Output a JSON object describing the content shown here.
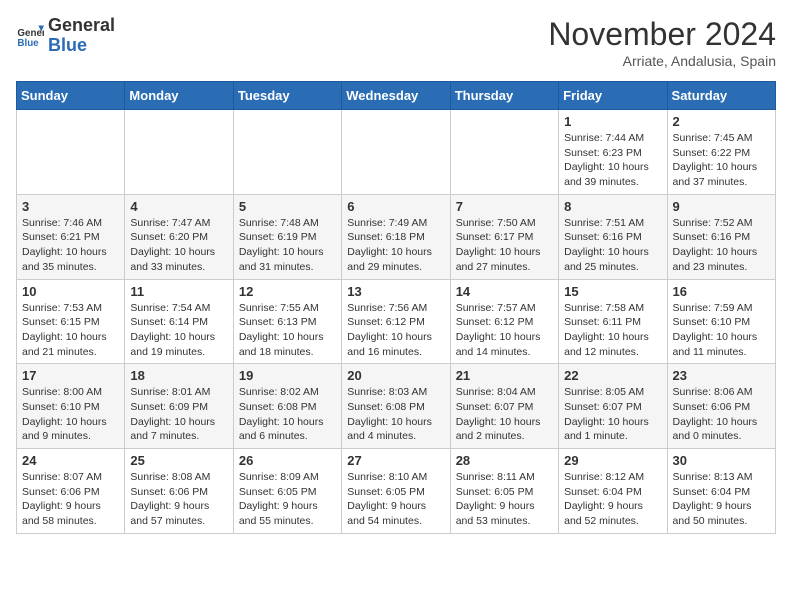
{
  "header": {
    "logo_general": "General",
    "logo_blue": "Blue",
    "month_title": "November 2024",
    "location": "Arriate, Andalusia, Spain"
  },
  "calendar": {
    "days_of_week": [
      "Sunday",
      "Monday",
      "Tuesday",
      "Wednesday",
      "Thursday",
      "Friday",
      "Saturday"
    ],
    "weeks": [
      [
        {
          "day": "",
          "info": ""
        },
        {
          "day": "",
          "info": ""
        },
        {
          "day": "",
          "info": ""
        },
        {
          "day": "",
          "info": ""
        },
        {
          "day": "",
          "info": ""
        },
        {
          "day": "1",
          "info": "Sunrise: 7:44 AM\nSunset: 6:23 PM\nDaylight: 10 hours and 39 minutes."
        },
        {
          "day": "2",
          "info": "Sunrise: 7:45 AM\nSunset: 6:22 PM\nDaylight: 10 hours and 37 minutes."
        }
      ],
      [
        {
          "day": "3",
          "info": "Sunrise: 7:46 AM\nSunset: 6:21 PM\nDaylight: 10 hours and 35 minutes."
        },
        {
          "day": "4",
          "info": "Sunrise: 7:47 AM\nSunset: 6:20 PM\nDaylight: 10 hours and 33 minutes."
        },
        {
          "day": "5",
          "info": "Sunrise: 7:48 AM\nSunset: 6:19 PM\nDaylight: 10 hours and 31 minutes."
        },
        {
          "day": "6",
          "info": "Sunrise: 7:49 AM\nSunset: 6:18 PM\nDaylight: 10 hours and 29 minutes."
        },
        {
          "day": "7",
          "info": "Sunrise: 7:50 AM\nSunset: 6:17 PM\nDaylight: 10 hours and 27 minutes."
        },
        {
          "day": "8",
          "info": "Sunrise: 7:51 AM\nSunset: 6:16 PM\nDaylight: 10 hours and 25 minutes."
        },
        {
          "day": "9",
          "info": "Sunrise: 7:52 AM\nSunset: 6:16 PM\nDaylight: 10 hours and 23 minutes."
        }
      ],
      [
        {
          "day": "10",
          "info": "Sunrise: 7:53 AM\nSunset: 6:15 PM\nDaylight: 10 hours and 21 minutes."
        },
        {
          "day": "11",
          "info": "Sunrise: 7:54 AM\nSunset: 6:14 PM\nDaylight: 10 hours and 19 minutes."
        },
        {
          "day": "12",
          "info": "Sunrise: 7:55 AM\nSunset: 6:13 PM\nDaylight: 10 hours and 18 minutes."
        },
        {
          "day": "13",
          "info": "Sunrise: 7:56 AM\nSunset: 6:12 PM\nDaylight: 10 hours and 16 minutes."
        },
        {
          "day": "14",
          "info": "Sunrise: 7:57 AM\nSunset: 6:12 PM\nDaylight: 10 hours and 14 minutes."
        },
        {
          "day": "15",
          "info": "Sunrise: 7:58 AM\nSunset: 6:11 PM\nDaylight: 10 hours and 12 minutes."
        },
        {
          "day": "16",
          "info": "Sunrise: 7:59 AM\nSunset: 6:10 PM\nDaylight: 10 hours and 11 minutes."
        }
      ],
      [
        {
          "day": "17",
          "info": "Sunrise: 8:00 AM\nSunset: 6:10 PM\nDaylight: 10 hours and 9 minutes."
        },
        {
          "day": "18",
          "info": "Sunrise: 8:01 AM\nSunset: 6:09 PM\nDaylight: 10 hours and 7 minutes."
        },
        {
          "day": "19",
          "info": "Sunrise: 8:02 AM\nSunset: 6:08 PM\nDaylight: 10 hours and 6 minutes."
        },
        {
          "day": "20",
          "info": "Sunrise: 8:03 AM\nSunset: 6:08 PM\nDaylight: 10 hours and 4 minutes."
        },
        {
          "day": "21",
          "info": "Sunrise: 8:04 AM\nSunset: 6:07 PM\nDaylight: 10 hours and 2 minutes."
        },
        {
          "day": "22",
          "info": "Sunrise: 8:05 AM\nSunset: 6:07 PM\nDaylight: 10 hours and 1 minute."
        },
        {
          "day": "23",
          "info": "Sunrise: 8:06 AM\nSunset: 6:06 PM\nDaylight: 10 hours and 0 minutes."
        }
      ],
      [
        {
          "day": "24",
          "info": "Sunrise: 8:07 AM\nSunset: 6:06 PM\nDaylight: 9 hours and 58 minutes."
        },
        {
          "day": "25",
          "info": "Sunrise: 8:08 AM\nSunset: 6:06 PM\nDaylight: 9 hours and 57 minutes."
        },
        {
          "day": "26",
          "info": "Sunrise: 8:09 AM\nSunset: 6:05 PM\nDaylight: 9 hours and 55 minutes."
        },
        {
          "day": "27",
          "info": "Sunrise: 8:10 AM\nSunset: 6:05 PM\nDaylight: 9 hours and 54 minutes."
        },
        {
          "day": "28",
          "info": "Sunrise: 8:11 AM\nSunset: 6:05 PM\nDaylight: 9 hours and 53 minutes."
        },
        {
          "day": "29",
          "info": "Sunrise: 8:12 AM\nSunset: 6:04 PM\nDaylight: 9 hours and 52 minutes."
        },
        {
          "day": "30",
          "info": "Sunrise: 8:13 AM\nSunset: 6:04 PM\nDaylight: 9 hours and 50 minutes."
        }
      ]
    ]
  }
}
